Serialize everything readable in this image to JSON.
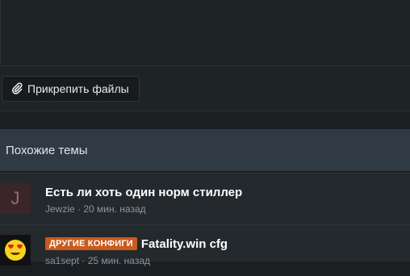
{
  "attach": {
    "label": "Прикрепить файлы",
    "icon": "paperclip-icon"
  },
  "similar": {
    "heading": "Похожие темы",
    "threads": [
      {
        "avatar_letter": "J",
        "title": "Есть ли хоть один норм стиллер",
        "author": "Jewzie",
        "separator": "·",
        "time": "20 мин. назад"
      },
      {
        "avatar_icon": "heart-eyes-emoji-avatar",
        "prefix": "ДРУГИЕ КОНФИГИ",
        "title": "Fatality.win cfg",
        "author": "sa1sept",
        "separator": "·",
        "time": "25 мин. назад"
      }
    ]
  },
  "colors": {
    "prefix": "#c95a1f",
    "header_bg": "#2f3a44",
    "page_bg": "#1b1f22"
  }
}
